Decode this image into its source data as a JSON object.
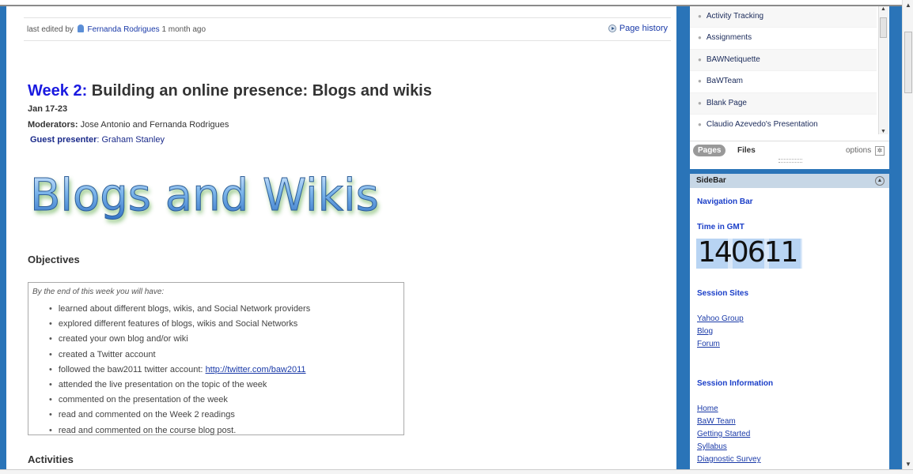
{
  "edit_bar": {
    "prefix": "last edited by",
    "user": "Fernanda Rodrigues",
    "time": "1 month ago",
    "history_label": "Page history"
  },
  "heading": {
    "week": "Week 2:",
    "title": "Building an online presence: Blogs and wikis",
    "dates": "Jan 17-23",
    "moderators_label": "Moderators:",
    "moderators": "Jose Antonio and Fernanda Rodrigues",
    "guest_label": "Guest presenter",
    "guest": "Graham Stanley"
  },
  "banner": {
    "text": "Blogs and Wikis"
  },
  "objectives": {
    "heading": "Objectives",
    "intro": "By the end of this week you will have:",
    "items": [
      "learned about different blogs, wikis, and Social Network providers",
      "explored different features of blogs, wikis and Social Networks",
      "created your own blog and/or wiki",
      "created a Twitter account",
      "followed the baw2011 twitter account:",
      "attended the live presentation on the topic of the week",
      "commented on the presentation of the week",
      "read and commented on the Week 2 readings",
      "read and commented on the course blog post."
    ],
    "twitter_link": "http://twitter.com/baw2011"
  },
  "activities": {
    "heading": "Activities"
  },
  "pages_panel": {
    "items": [
      "Activity Tracking",
      "Assignments",
      "BAWNetiquette",
      "BaWTeam",
      "Blank Page",
      "Claudio Azevedo's Presentation"
    ],
    "tab_pages": "Pages",
    "tab_files": "Files",
    "options": "options"
  },
  "sidebar": {
    "header": "SideBar",
    "nav_bar": "Navigation Bar",
    "time_title": "Time in GMT",
    "clock": "140611",
    "session_sites": "Session Sites",
    "site_links": [
      "Yahoo Group",
      "Blog",
      "Forum"
    ],
    "session_info": "Session Information",
    "info_links": [
      "Home",
      "BaW Team",
      "Getting Started",
      "Syllabus",
      "Diagnostic Survey"
    ]
  }
}
